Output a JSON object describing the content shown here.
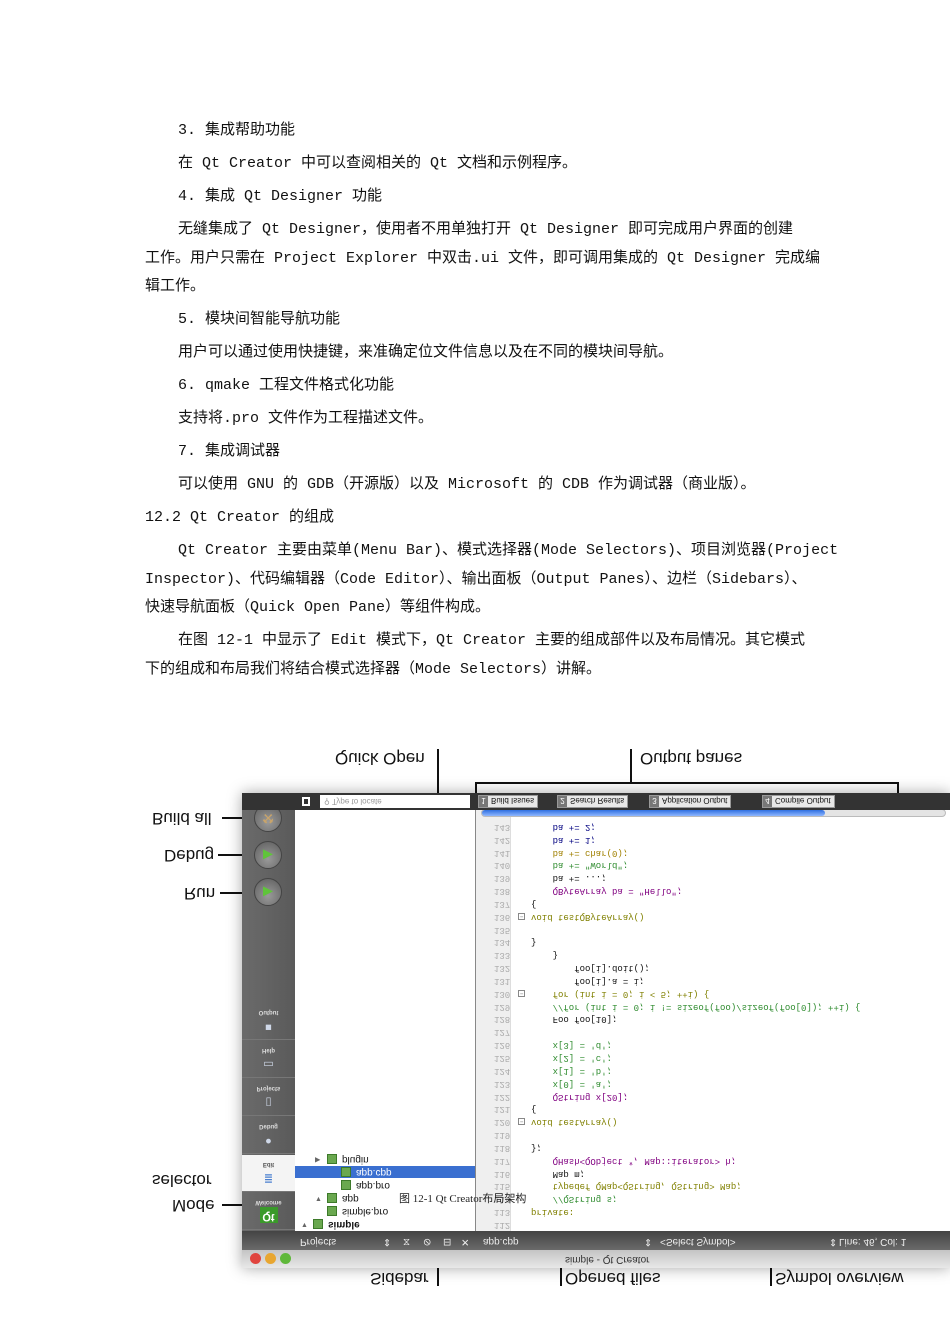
{
  "document": {
    "paragraphs": [
      {
        "indent": true,
        "lines": [
          "3. 集成帮助功能"
        ]
      },
      {
        "indent": true,
        "lines": [
          "在 Qt Creator 中可以查阅相关的 Qt 文档和示例程序。"
        ]
      },
      {
        "indent": true,
        "lines": [
          "4. 集成 Qt Designer 功能"
        ]
      },
      {
        "indent": true,
        "lines": [
          "无缝集成了 Qt Designer，使用者不用单独打开 Qt Designer 即可完成用户界面的创建",
          "工作。用户只需在 Project Explorer 中双击.ui 文件，即可调用集成的 Qt Designer 完成编",
          "辑工作。"
        ]
      },
      {
        "indent": true,
        "lines": [
          "5. 模块间智能导航功能"
        ]
      },
      {
        "indent": true,
        "lines": [
          "用户可以通过使用快捷键，来准确定位文件信息以及在不同的模块间导航。"
        ]
      },
      {
        "indent": true,
        "lines": [
          "6. qmake 工程文件格式化功能"
        ]
      },
      {
        "indent": true,
        "lines": [
          "支持将.pro 文件作为工程描述文件。"
        ]
      },
      {
        "indent": true,
        "lines": [
          "7. 集成调试器"
        ]
      },
      {
        "indent": true,
        "lines": [
          "可以使用 GNU 的 GDB（开源版）以及 Microsoft 的 CDB 作为调试器（商业版）。"
        ]
      },
      {
        "indent": false,
        "lines": [
          "12.2 Qt Creator 的组成"
        ]
      },
      {
        "indent": true,
        "lines": [
          "Qt Creator 主要由菜单(Menu Bar)、模式选择器(Mode Selectors)、项目浏览器(Project",
          "Inspector)、代码编辑器（Code Editor）、输出面板（Output Panes）、边栏（Sidebars）、",
          "快速导航面板（Quick Open Pane）等组件构成。"
        ]
      },
      {
        "indent": true,
        "lines": [
          "在图 12-1 中显示了 Edit 模式下，Qt Creator 主要的组成部件以及布局情况。其它模式",
          "下的组成和布局我们将结合模式选择器（Mode Selectors）讲解。"
        ]
      }
    ]
  },
  "figure": {
    "caption": "图 12-1 Qt Creator布局架构",
    "callouts": {
      "quick_open": "Quick Open",
      "output_panes": "Output panes",
      "build_all": "Build all",
      "debug": "Debug",
      "run": "Run",
      "mode": "Mode",
      "selector": "selector",
      "sidebar": "Sidebar",
      "opened_files": "Opened files",
      "symbol_overview": "Symbol overview"
    },
    "window_title": "simple - Qt Creator",
    "statusbar": {
      "sidebar_view": "Projects",
      "open_file": "app.cpp",
      "symbol": "<Select Symbol>",
      "position": "Line: 46, Col: 1"
    },
    "quick_open_placeholder": "Type to locate",
    "output_tabs": [
      {
        "num": "1",
        "label": "Build Issues"
      },
      {
        "num": "2",
        "label": "Search Results"
      },
      {
        "num": "3",
        "label": "Application Output"
      },
      {
        "num": "4",
        "label": "Compile Output"
      }
    ],
    "build_progress": 0.74,
    "modes": [
      "Welcome",
      "Edit",
      "Debug",
      "Projects",
      "Help",
      "Output"
    ],
    "selected_mode": "Edit",
    "tree": [
      {
        "label": "simple",
        "level": 0,
        "arrow": "▼"
      },
      {
        "label": "simple.pro",
        "level": 1
      },
      {
        "label": "app",
        "level": 1,
        "arrow": "▼"
      },
      {
        "label": "app.pro",
        "level": 2
      },
      {
        "label": "app.cpp",
        "level": 2,
        "selected": true
      },
      {
        "label": "plugin",
        "level": 1,
        "arrow": "▶"
      }
    ],
    "code": [
      {
        "n": "112",
        "t": ""
      },
      {
        "n": "113",
        "t": "private:",
        "c": "#808000"
      },
      {
        "n": "114",
        "t": "    //QString s;",
        "c": "#2e8b2e"
      },
      {
        "n": "115",
        "t": "    typedef QMap<QString, QString> Map;",
        "c": "#808000"
      },
      {
        "n": "116",
        "t": "    Map m;"
      },
      {
        "n": "117",
        "t": "    QHash<QObject *, Map::iterator> h;",
        "c": "#800080"
      },
      {
        "n": "118",
        "t": "};"
      },
      {
        "n": "119",
        "t": ""
      },
      {
        "n": "120",
        "t": "void testArray()",
        "fold": true,
        "c": "#808000"
      },
      {
        "n": "121",
        "t": "{"
      },
      {
        "n": "122",
        "t": "    QString x[20];",
        "c": "#800080"
      },
      {
        "n": "123",
        "t": "    x[0] = 'a';",
        "c": "#2e8b2e"
      },
      {
        "n": "124",
        "t": "    x[1] = 'b';",
        "c": "#2e8b2e"
      },
      {
        "n": "125",
        "t": "    x[2] = 'c';",
        "c": "#2e8b2e"
      },
      {
        "n": "126",
        "t": "    x[3] = 'd';",
        "c": "#2e8b2e"
      },
      {
        "n": "127",
        "t": ""
      },
      {
        "n": "128",
        "t": "    Foo foo[10];"
      },
      {
        "n": "129",
        "t": "    //for (int i = 0; i != sizeof(foo)/sizeof(foo[0]); ++i) {",
        "c": "#2e8b2e"
      },
      {
        "n": "130",
        "t": "    for (int i = 0; i < 5; ++i) {",
        "fold": true,
        "c": "#808000"
      },
      {
        "n": "131",
        "t": "        foo[i].a = i;"
      },
      {
        "n": "132",
        "t": "        foo[i].doit();"
      },
      {
        "n": "133",
        "t": "    }"
      },
      {
        "n": "134",
        "t": "}"
      },
      {
        "n": "135",
        "t": ""
      },
      {
        "n": "136",
        "t": "void testQByteArray()",
        "fold": true,
        "c": "#808000"
      },
      {
        "n": "137",
        "t": "{"
      },
      {
        "n": "138",
        "t": "    QByteArray ba = \"Hello\";",
        "c": "#800080"
      },
      {
        "n": "139",
        "t": "    ba += ...;"
      },
      {
        "n": "140",
        "t": "    ba += \"World\";",
        "c": "#2e8b2e"
      },
      {
        "n": "141",
        "t": "    ba += char(0);",
        "c": "#a08000"
      },
      {
        "n": "142",
        "t": "    ba += 1;",
        "c": "#000080"
      },
      {
        "n": "143",
        "t": "    ba += 2;",
        "c": "#000080"
      }
    ]
  }
}
